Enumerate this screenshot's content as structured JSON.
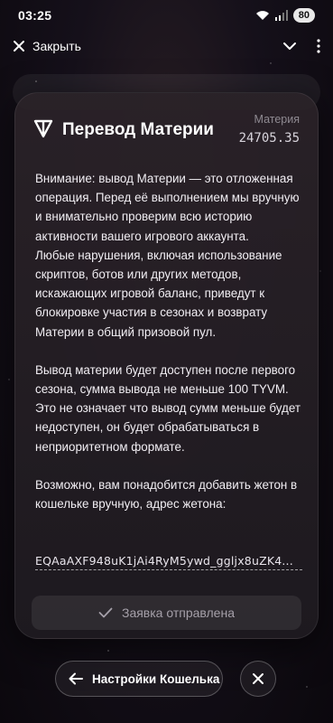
{
  "status_bar": {
    "time": "03:25",
    "battery": "80",
    "icons": [
      "wifi-icon",
      "signal-icon"
    ]
  },
  "top_bar": {
    "close_label": "Закрыть",
    "icons": [
      "close-icon",
      "chevron-down-icon",
      "more-vertical-icon"
    ]
  },
  "card": {
    "title": "Перевод Материи",
    "balance_label": "Материя",
    "balance_value": "24705.35",
    "paragraphs": [
      "Внимание: вывод Материи — это отложенная операция. Перед её выполнением мы вручную и внимательно проверим всю историю активности вашего игрового аккаунта.\nЛюбые нарушения, включая использование скриптов, ботов или других методов, искажающих игровой баланс, приведут к блокировке участия в сезонах и возврату Материи в общий призовой пул.",
      "Вывод материи будет доступен после первого сезона, сумма вывода не меньше 100 TYVM.\nЭто не означает что вывод сумм меньше будет недоступен, он будет обрабатываться в неприоритетном формате.",
      "Возможно, вам понадобится добавить жетон в кошельке вручную, адрес жетона:"
    ],
    "token_address": "EQAaAXF948uK1jAi4RyM5ywd_ggljx8uZK4...",
    "submit_label": "Заявка отправлена"
  },
  "bottom": {
    "wallet_settings_label": "Настройки Кошелька"
  },
  "colors": {
    "background": "#15101a",
    "card": "#2a2228",
    "muted": "#8f8a92"
  }
}
